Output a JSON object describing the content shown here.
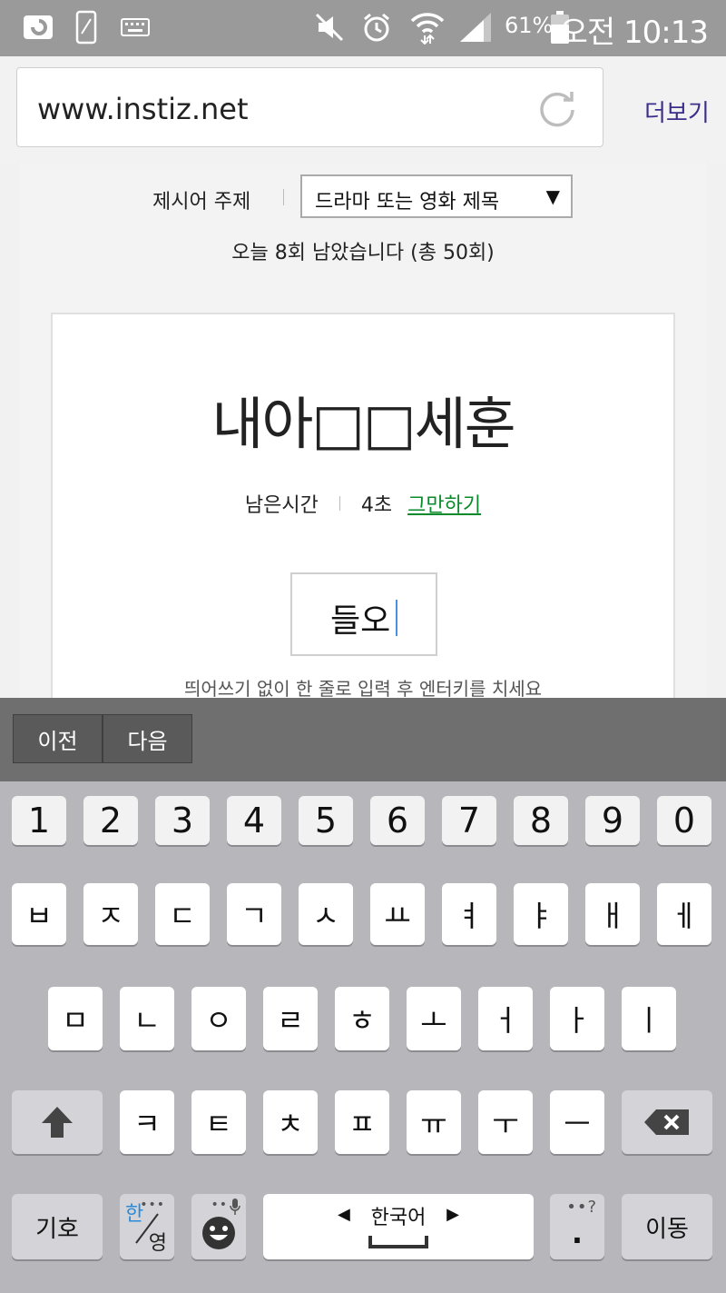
{
  "status_bar": {
    "battery": "61%",
    "time": "오전 10:13"
  },
  "address_bar": {
    "url": "www.instiz.net",
    "more_label": "더보기"
  },
  "game": {
    "topic_label": "제시어 주제",
    "topic_value": "드라마 또는 영화 제목",
    "remaining_text": "오늘 8회 남았습니다 (총 50회)",
    "puzzle_text": "내아□□세훈",
    "time_label": "남은시간",
    "time_value": "4초",
    "stop_label": "그만하기",
    "answer_value": "들오",
    "hint_text": "띄어쓰기 없이 한 줄로 입력 후 엔터키를 치세요"
  },
  "keyboard": {
    "prev_label": "이전",
    "next_label": "다음",
    "numbers": [
      "1",
      "2",
      "3",
      "4",
      "5",
      "6",
      "7",
      "8",
      "9",
      "0"
    ],
    "row1": [
      "ㅂ",
      "ㅈ",
      "ㄷ",
      "ㄱ",
      "ㅅ",
      "ㅛ",
      "ㅕ",
      "ㅑ",
      "ㅐ",
      "ㅔ"
    ],
    "row2": [
      "ㅁ",
      "ㄴ",
      "ㅇ",
      "ㄹ",
      "ㅎ",
      "ㅗ",
      "ㅓ",
      "ㅏ",
      "ㅣ"
    ],
    "row3": [
      "ㅋ",
      "ㅌ",
      "ㅊ",
      "ㅍ",
      "ㅠ",
      "ㅜ",
      "ㅡ"
    ],
    "symbols_label": "기호",
    "lang_top": "한",
    "lang_bottom": "영",
    "space_label": "한국어",
    "period_label": ".",
    "move_label": "이동"
  }
}
